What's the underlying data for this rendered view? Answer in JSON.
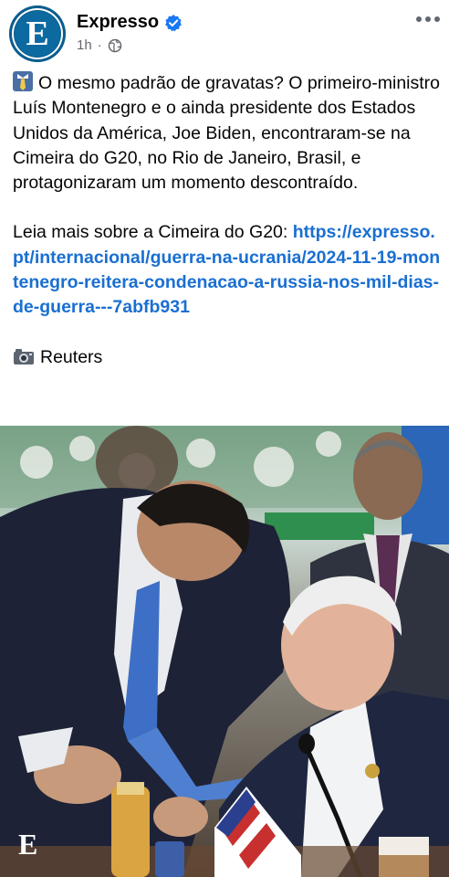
{
  "header": {
    "page_name": "Expresso",
    "avatar_letter": "E",
    "timestamp": "1h",
    "separator": "·"
  },
  "post": {
    "emoji_tie": "👔",
    "paragraph1": "O mesmo padrão de gravatas? O primeiro-ministro Luís Montenegro e o ainda presidente dos Estados Unidos da América, Joe Biden, encontraram-se na Cimeira do G20, no Rio de Janeiro, Brasil, e protagonizaram um momento descontraído.",
    "paragraph2_prefix": "Leia mais sobre a Cimeira do G20: ",
    "link": "https://expresso.pt/internacional/guerra-na-ucrania/2024-11-19-montenegro-reitera-condenacao-a-russia-nos-mil-dias-de-guerra---7abfb931",
    "emoji_camera": "📷",
    "credit": "Reuters"
  },
  "photo": {
    "watermark": "E"
  },
  "colors": {
    "brand_blue": "#0d6aa0",
    "link_blue": "#1a6fd1",
    "verified_blue": "#1877f2"
  }
}
